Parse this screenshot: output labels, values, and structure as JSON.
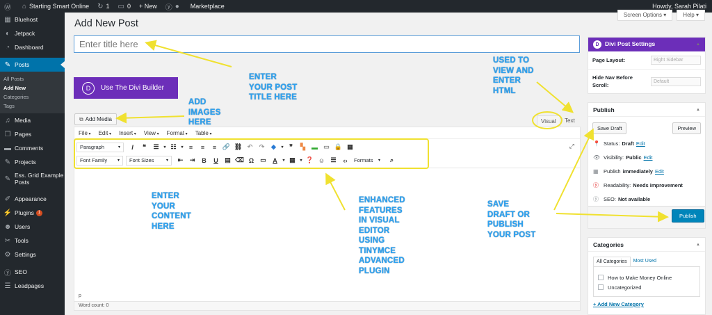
{
  "adminbar": {
    "site": "Starting Smart Online",
    "updates": "1",
    "comments": "0",
    "new_label": "+ New",
    "marketplace": "Marketplace",
    "howdy": "Howdy, Sarah Pilati"
  },
  "sidebar": {
    "items": [
      {
        "label": "Bluehost",
        "icon": "grid-icon"
      },
      {
        "label": "Jetpack",
        "icon": "jetpack-icon"
      },
      {
        "label": "Dashboard",
        "icon": "dashboard-icon"
      },
      {
        "label": "Posts",
        "icon": "pin-icon"
      }
    ],
    "posts_sub": [
      "All Posts",
      "Add New",
      "Categories",
      "Tags"
    ],
    "items2": [
      {
        "label": "Media",
        "icon": "media-icon"
      },
      {
        "label": "Pages",
        "icon": "pages-icon"
      },
      {
        "label": "Comments",
        "icon": "comments-icon"
      },
      {
        "label": "Projects",
        "icon": "projects-icon"
      },
      {
        "label": "Ess. Grid Example Posts",
        "icon": "pin-icon"
      },
      {
        "label": "Appearance",
        "icon": "appearance-icon"
      },
      {
        "label": "Plugins",
        "icon": "plugin-icon",
        "badge": "1"
      },
      {
        "label": "Users",
        "icon": "users-icon"
      },
      {
        "label": "Tools",
        "icon": "tools-icon"
      },
      {
        "label": "Settings",
        "icon": "settings-icon"
      },
      {
        "label": "SEO",
        "icon": "seo-icon"
      },
      {
        "label": "Leadpages",
        "icon": "leadpages-icon"
      }
    ]
  },
  "top": {
    "screen_options": "Screen Options ▾",
    "help": "Help ▾"
  },
  "page_title": "Add New Post",
  "title_placeholder": "Enter title here",
  "divi_button": "Use The Divi Builder",
  "divi_letter": "D",
  "add_media": "Add Media",
  "tabs": {
    "visual": "Visual",
    "text": "Text"
  },
  "menubar": [
    "File",
    "Edit",
    "Insert",
    "View",
    "Format",
    "Table"
  ],
  "toolbar": {
    "paragraph": "Paragraph",
    "font_family": "Font Family",
    "font_sizes": "Font Sizes",
    "formats": "Formats"
  },
  "editor": {
    "path": "p",
    "word_count": "Word count: 0"
  },
  "divi_settings": {
    "title": "Divi Post Settings",
    "page_layout_label": "Page Layout:",
    "page_layout_value": "Right Sidebar",
    "nav_label_1": "Hide Nav Before",
    "nav_label_2": "Scroll:",
    "nav_value": "Default"
  },
  "publish": {
    "title": "Publish",
    "save_draft": "Save Draft",
    "preview": "Preview",
    "status_label": "Status:",
    "status_value": "Draft",
    "visibility_label": "Visibility:",
    "visibility_value": "Public",
    "publish_label": "Publish",
    "publish_value": "immediately",
    "readability_label": "Readability:",
    "readability_value": "Needs improvement",
    "seo_label": "SEO:",
    "seo_value": "Not available",
    "edit": "Edit",
    "publish_button": "Publish"
  },
  "categories": {
    "title": "Categories",
    "tab_all": "All Categories",
    "tab_used": "Most Used",
    "items": [
      "How to Make Money Online",
      "Uncategorized"
    ],
    "add_new": "+ Add New Category"
  },
  "annotations": {
    "title": [
      "ENTER",
      "YOUR POST",
      "TITLE HERE"
    ],
    "images": [
      "ADD",
      "IMAGES",
      "HERE"
    ],
    "html": [
      "USED TO",
      "VIEW AND",
      "ENTER",
      "HTML"
    ],
    "content": [
      "ENTER",
      "YOUR",
      "CONTENT",
      "HERE"
    ],
    "features": [
      "ENHANCED",
      "FEATURES",
      "IN VISUAL",
      "EDITOR",
      "USING",
      "TINYMCE",
      "ADVANCED",
      "PLUGIN"
    ],
    "save": [
      "SAVE",
      "DRAFT OR",
      "PUBLISH",
      "YOUR POST"
    ]
  },
  "colors": {
    "accent": "#0073aa",
    "divi": "#6c2eb9",
    "annotation": "#2ea3f2",
    "highlight": "#f0e130"
  }
}
